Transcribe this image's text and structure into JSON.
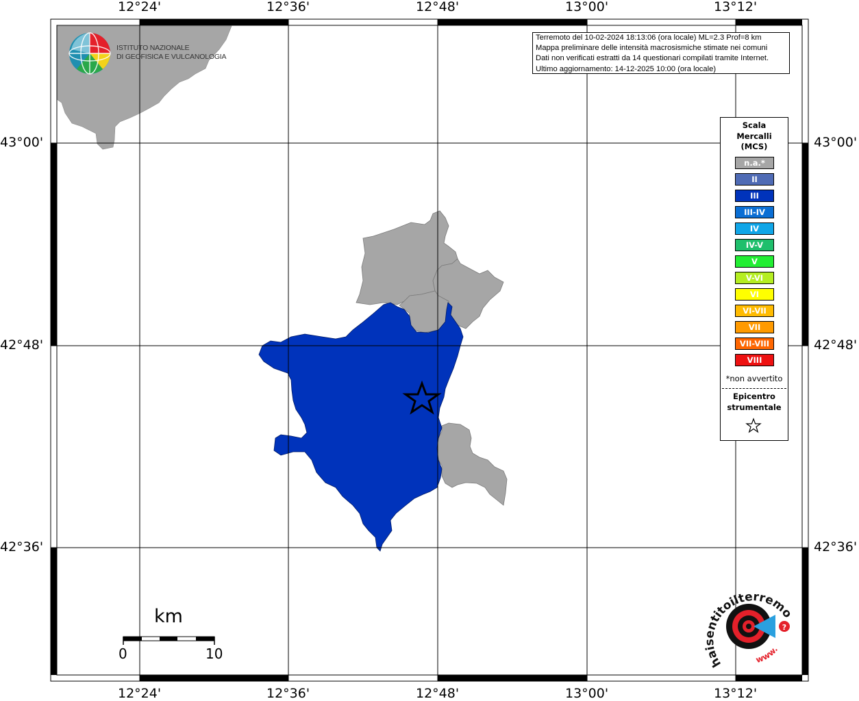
{
  "info": {
    "line1": "Terremoto del 10-02-2024 18:13:06 (ora locale) ML=2.3 Prof=8 km",
    "line2": "Mappa preliminare delle intensità macrosismiche stimate nei comuni",
    "line3": "Dati non verificati estratti da 14 questionari compilati tramite Internet.",
    "line4": "Ultimo aggiornamento: 14-12-2025 10:00 (ora locale)"
  },
  "ingv": {
    "line1": "ISTITUTO NAZIONALE",
    "line2": "DI GEOFISICA E VULCANOLOGIA"
  },
  "axes": {
    "top": [
      "12°24'",
      "12°36'",
      "12°48'",
      "13°00'",
      "13°12'"
    ],
    "bottom": [
      "12°24'",
      "12°36'",
      "12°48'",
      "13°00'",
      "13°12'"
    ],
    "left": [
      "43°00'",
      "42°48'",
      "42°36'"
    ],
    "right": [
      "43°00'",
      "42°48'",
      "42°36'"
    ]
  },
  "legend": {
    "title_line1": "Scala",
    "title_line2": "Mercalli",
    "title_line3": "(MCS)",
    "classes": [
      {
        "label": "n.a.*",
        "color": "#a6a6a6"
      },
      {
        "label": "II",
        "color": "#4f6bb5"
      },
      {
        "label": "III",
        "color": "#0033bb"
      },
      {
        "label": "III-IV",
        "color": "#0a6ed4"
      },
      {
        "label": "IV",
        "color": "#10a6e8"
      },
      {
        "label": "IV-V",
        "color": "#1fbf6c"
      },
      {
        "label": "V",
        "color": "#22ee33"
      },
      {
        "label": "V-VI",
        "color": "#b5ee22"
      },
      {
        "label": "VI",
        "color": "#ffff00"
      },
      {
        "label": "VI-VII",
        "color": "#ffbb00"
      },
      {
        "label": "VII",
        "color": "#ff9a00"
      },
      {
        "label": "VII-VIII",
        "color": "#ff6600"
      },
      {
        "label": "VIII",
        "color": "#ee1111"
      }
    ],
    "note": "*non avvertito",
    "epicentre_line1": "Epicentro",
    "epicentre_line2": "strumentale"
  },
  "scale_bar": {
    "unit": "km",
    "min": "0",
    "max": "10"
  },
  "hsit_logo": {
    "arc_text": "haisentitoilterremoto.it",
    "www_text": "www."
  },
  "colors": {
    "not_felt_gray": "#a6a6a6",
    "intensity_III": "#0033bb",
    "logo_red": "#e4202a"
  }
}
